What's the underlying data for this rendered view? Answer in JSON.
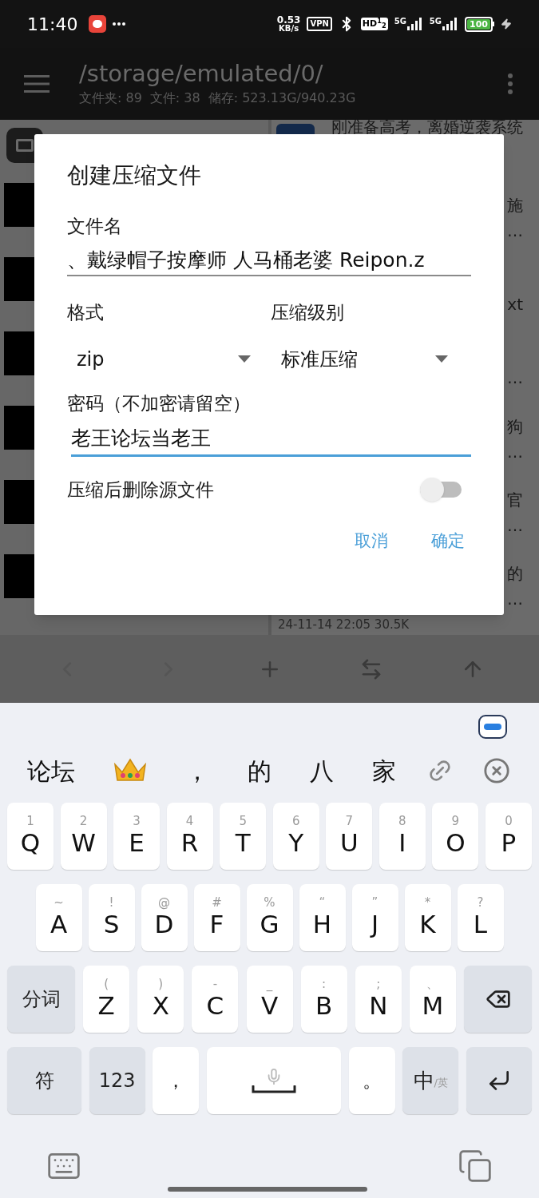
{
  "status_bar": {
    "time": "11:40",
    "net_speed": [
      "0.53",
      "KB/s"
    ],
    "vpn": "VPN",
    "hd": "HD$^{1}$$_{2}$",
    "networks": [
      "5G",
      "5G"
    ],
    "battery": "100"
  },
  "app_bar": {
    "title": "/storage/emulated/0/",
    "stats": [
      "文件夹: 89",
      "文件: 38",
      "储存: 523.13G/940.23G"
    ]
  },
  "file_list": {
    "right_rows": [
      {
        "title": "刚准备高考，离婚逆袭系统"
      },
      {
        "title": "施",
        "line_2": "…"
      },
      {
        "line_2": "xt"
      },
      {
        "line_2": "…"
      },
      {
        "title": "狗",
        "line_2": "…"
      },
      {
        "title": "官",
        "line_2": "…"
      },
      {
        "title": "的",
        "line_2": "…",
        "meta": "24-11-14 22:05 30.5K"
      }
    ]
  },
  "dialog": {
    "title": "创建压缩文件",
    "filename_label": "文件名",
    "filename_value": "、戴绿帽子按摩师 人马桶老婆 Reipon.z",
    "format_label": "格式",
    "format_value": "zip",
    "level_label": "压缩级别",
    "level_value": "标准压缩",
    "password_label": "密码（不加密请留空）",
    "password_value": "老王论坛当老王",
    "password_focused": true,
    "delete_label": "压缩后删除源文件",
    "delete_on": false,
    "buttons": [
      "取消",
      "确定"
    ]
  },
  "keyboard": {
    "candidates": [
      {
        "kind": "text",
        "text": "论坛"
      },
      {
        "kind": "crown"
      },
      {
        "kind": "text",
        "text": "，"
      },
      {
        "kind": "text",
        "text": "的"
      },
      {
        "kind": "text",
        "text": "八"
      },
      {
        "kind": "text",
        "text": "家"
      }
    ],
    "rows": [
      {
        "keys": [
          {
            "kind": "letter",
            "label": "Q",
            "hint": "1"
          },
          {
            "kind": "letter",
            "label": "W",
            "hint": "2"
          },
          {
            "kind": "letter",
            "label": "E",
            "hint": "3"
          },
          {
            "kind": "letter",
            "label": "R",
            "hint": "4"
          },
          {
            "kind": "letter",
            "label": "T",
            "hint": "5"
          },
          {
            "kind": "letter",
            "label": "Y",
            "hint": "6"
          },
          {
            "kind": "letter",
            "label": "U",
            "hint": "7"
          },
          {
            "kind": "letter",
            "label": "I",
            "hint": "8"
          },
          {
            "kind": "letter",
            "label": "O",
            "hint": "9"
          },
          {
            "kind": "letter",
            "label": "P",
            "hint": "0"
          }
        ]
      },
      {
        "keys": [
          {
            "kind": "letter",
            "label": "A",
            "hint": "~"
          },
          {
            "kind": "letter",
            "label": "S",
            "hint": "!"
          },
          {
            "kind": "letter",
            "label": "D",
            "hint": "@"
          },
          {
            "kind": "letter",
            "label": "F",
            "hint": "#"
          },
          {
            "kind": "letter",
            "label": "G",
            "hint": "%"
          },
          {
            "kind": "letter",
            "label": "H",
            "hint": "“"
          },
          {
            "kind": "letter",
            "label": "J",
            "hint": "”"
          },
          {
            "kind": "letter",
            "label": "K",
            "hint": "*"
          },
          {
            "kind": "letter",
            "label": "L",
            "hint": "?"
          }
        ]
      },
      {
        "keys": [
          {
            "kind": "function",
            "label": "分词"
          },
          {
            "kind": "letter",
            "label": "Z",
            "hint": "("
          },
          {
            "kind": "letter",
            "label": "X",
            "hint": ")"
          },
          {
            "kind": "letter",
            "label": "C",
            "hint": "-"
          },
          {
            "kind": "letter",
            "label": "V",
            "hint": "_"
          },
          {
            "kind": "letter",
            "label": "B",
            "hint": ":"
          },
          {
            "kind": "letter",
            "label": "N",
            "hint": ";"
          },
          {
            "kind": "letter",
            "label": "M",
            "hint": "、"
          },
          {
            "kind": "backspace"
          }
        ]
      },
      {
        "keys": [
          {
            "kind": "function",
            "label": "符"
          },
          {
            "kind": "function",
            "label": "123"
          },
          {
            "kind": "punct",
            "label": "，"
          },
          {
            "kind": "space"
          },
          {
            "kind": "punct",
            "label": "。"
          },
          {
            "kind": "lang",
            "label": "中",
            "sub": "/英"
          },
          {
            "kind": "enter"
          }
        ]
      }
    ]
  }
}
